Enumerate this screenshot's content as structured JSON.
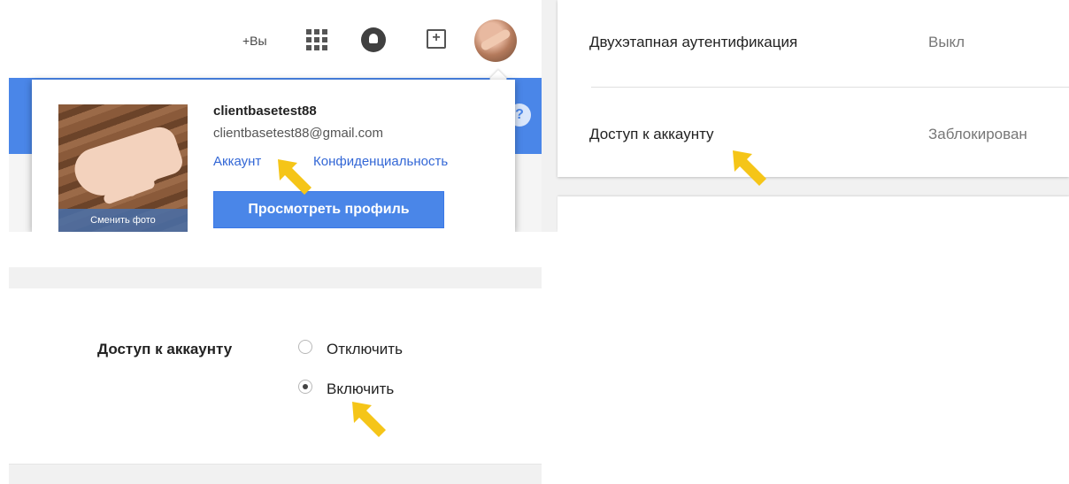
{
  "header": {
    "plus_you": "+Вы",
    "icons": [
      "apps-icon",
      "notifications-icon",
      "share-icon",
      "avatar"
    ]
  },
  "account_popup": {
    "photo_caption": "Сменить фото",
    "username": "clientbasetest88",
    "email": "clientbasetest88@gmail.com",
    "account_link": "Аккаунт",
    "privacy_link": "Конфиденциальность",
    "view_profile_button": "Просмотреть профиль"
  },
  "security": {
    "rows": [
      {
        "label": "Двухэтапная аутентификация",
        "value": "Выкл"
      },
      {
        "label": "Доступ к аккаунту",
        "value": "Заблокирован"
      }
    ]
  },
  "access_setting": {
    "label": "Доступ к аккаунту",
    "options": [
      {
        "label": "Отключить",
        "selected": false
      },
      {
        "label": "Включить",
        "selected": true
      }
    ]
  },
  "colors": {
    "accent_blue": "#4a86e8",
    "link_blue": "#3367d6",
    "arrow_yellow": "#f5c518"
  }
}
